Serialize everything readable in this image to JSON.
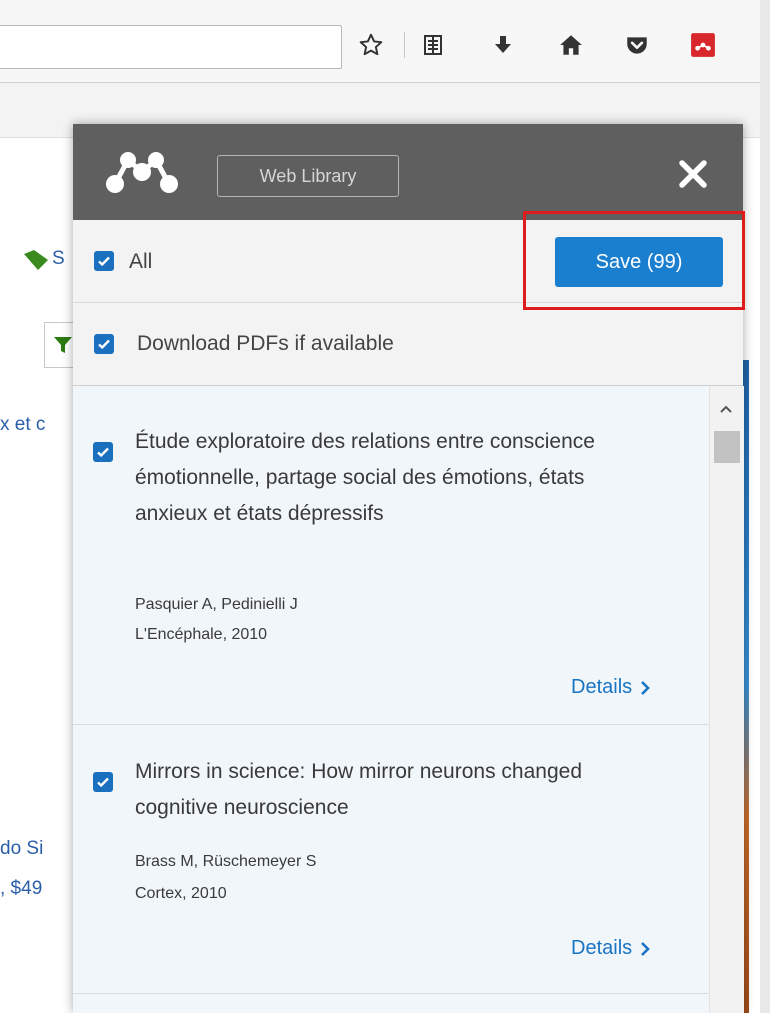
{
  "browser": {
    "icons": [
      "star-icon",
      "reader-view-icon",
      "download-icon",
      "home-icon",
      "pocket-icon",
      "mendeley-extension-icon"
    ],
    "accent": "#d9282b"
  },
  "background": {
    "fragments": [
      "S",
      "x et c",
      "do Si",
      ", $49"
    ]
  },
  "panel": {
    "web_library_label": "Web Library",
    "select_all_label": "All",
    "save_button_label": "Save (99)",
    "download_pdfs_label": "Download PDFs if available",
    "accent_color": "#1b7fd0",
    "highlight_color": "#e01b1b"
  },
  "items": [
    {
      "title": "Étude exploratoire des relations entre conscience émotionnelle, partage social des émotions, états anxieux et états dépressifs",
      "authors": "Pasquier A,  Pedinielli J",
      "source": "L'Encéphale, 2010",
      "details_label": "Details"
    },
    {
      "title": "Mirrors in science: How mirror neurons changed cognitive neuroscience",
      "authors": "Brass M,  Rüschemeyer S",
      "source": "Cortex, 2010",
      "details_label": "Details"
    }
  ]
}
